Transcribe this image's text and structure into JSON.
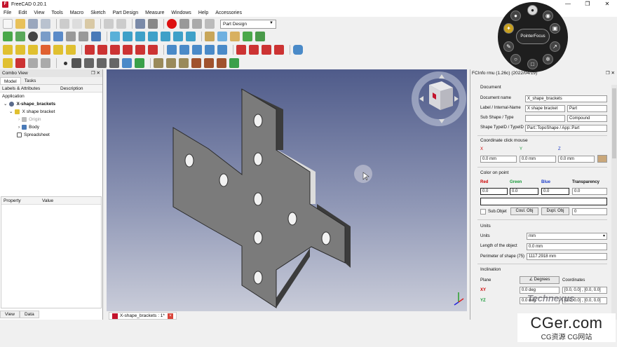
{
  "window": {
    "title": "FreeCAD 0.20.1",
    "controls": [
      "—",
      "❐",
      "✕"
    ]
  },
  "menu": [
    "File",
    "Edit",
    "View",
    "Tools",
    "Macro",
    "Sketch",
    "Part Design",
    "Measure",
    "Windows",
    "Help",
    "Accessories"
  ],
  "workbench": {
    "selected": "Part Design"
  },
  "combo_view": {
    "title": "Combo View",
    "tabs": [
      "Model",
      "Tasks"
    ],
    "columns": [
      "Labels & Attributes",
      "Description"
    ],
    "tree": {
      "application": "Application",
      "document": "X-shape_brackets",
      "part": "X shape bracket",
      "origin": "Origin",
      "body": "Body",
      "spreadsheet": "Spreadsheet"
    },
    "property_columns": [
      "Property",
      "Value"
    ],
    "bottom_tabs": [
      "View",
      "Data"
    ]
  },
  "pie_menu": {
    "center_label": "PointerFocus"
  },
  "document_tab": {
    "label": "X-shape_brackets : 1*",
    "close": "×"
  },
  "fcinfo": {
    "title": "FCInfo rmu (1.26c) (2022/04/19)",
    "document": {
      "section": "Document",
      "name_label": "Document name",
      "name_value": "X_shape_brackets",
      "label_label": "Label / Internal-Name",
      "label_value": "X shape bracket",
      "internal_value": "Part",
      "subshape_label": "Sub Shape / Type",
      "subshape_value": "",
      "type_value": "Compound",
      "typeid_label": "Shape TypeID / TypeID",
      "typeid_value": "Part::TopoShape / App::Part"
    },
    "coords": {
      "section": "Coordinate click mouse",
      "x_label": "X",
      "y_label": "Y",
      "z_label": "Z",
      "x_value": "0.0 mm",
      "y_value": "0.0 mm",
      "z_value": "0.0 mm"
    },
    "color": {
      "section": "Color on point",
      "red_label": "Red",
      "green_label": "Green",
      "blue_label": "Blue",
      "transparency_label": "Transparency",
      "red": "0.0",
      "green": "0.0",
      "blue": "0.0",
      "transparency": "0.0",
      "subobj_label": "Sub.Objet",
      "coul_label": "Coul. Obj",
      "dupl_label": "Dupl. Obj",
      "spin_value": "0"
    },
    "units": {
      "section": "Units",
      "units_label": "Units",
      "units_value": "mm",
      "length_label": "Length of the object",
      "length_value": "0.0 mm",
      "perimeter_label": "Perimeter of shape (75)",
      "perimeter_value": "1117.2918 mm"
    },
    "inclination": {
      "section": "Inclination",
      "plane_label": "Plane",
      "degrees_button": "Degrees",
      "coordinates_label": "Coordinates",
      "xy_label": "XY",
      "yz_label": "YZ",
      "xy_value": "0.0 deg",
      "yz_value": "0.0 deg",
      "xy_coords": "[0.0, 0.0] , [0.0, 0.0]",
      "yz_coords": "[0.0, 0.0] , [0.0, 0.0]"
    }
  },
  "watermark": {
    "brand": "CGer.com",
    "sub": "CG资源 CG网站",
    "tech": "Technexus"
  },
  "colors": {
    "accent": "#1a9a3a",
    "red": "#c3142d",
    "viewport_top": "#4f5b8a",
    "viewport_bottom": "#c9ccd9"
  }
}
